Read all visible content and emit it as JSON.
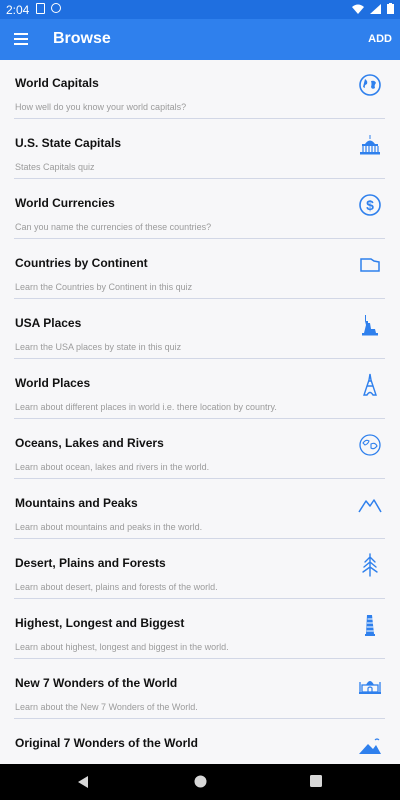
{
  "status": {
    "time": "2:04"
  },
  "appbar": {
    "title": "Browse",
    "add_label": "ADD"
  },
  "items": [
    {
      "title": "World Capitals",
      "desc": "How well do you know your world capitals?",
      "icon": "globe-icon"
    },
    {
      "title": "U.S. State Capitals",
      "desc": "States Capitals  quiz",
      "icon": "capitol-building-icon"
    },
    {
      "title": "World Currencies",
      "desc": "Can you name the currencies of these countries?",
      "icon": "dollar-icon"
    },
    {
      "title": "Countries by Continent",
      "desc": "Learn the Countries by Continent in this quiz",
      "icon": "map-outline-icon"
    },
    {
      "title": "USA Places",
      "desc": "Learn the USA places by state in this quiz",
      "icon": "statue-of-liberty-icon"
    },
    {
      "title": "World Places",
      "desc": "Learn about different places in world i.e. there location by country.",
      "icon": "eiffel-tower-icon"
    },
    {
      "title": "Oceans, Lakes and Rivers",
      "desc": "Learn about ocean, lakes and rivers in the world.",
      "icon": "earth-map-icon"
    },
    {
      "title": "Mountains and Peaks",
      "desc": "Learn about mountains and peaks in the world.",
      "icon": "mountain-icon"
    },
    {
      "title": "Desert, Plains and Forests",
      "desc": "Learn about desert, plains and forests of the world.",
      "icon": "pine-tree-icon"
    },
    {
      "title": "Highest, Longest and Biggest",
      "desc": "Learn about highest, longest and biggest in the world.",
      "icon": "leaning-tower-icon"
    },
    {
      "title": "New 7 Wonders of the World",
      "desc": "Learn about the New 7 Wonders of the World.",
      "icon": "taj-mahal-icon"
    },
    {
      "title": "Original 7 Wonders of the World",
      "desc": "",
      "icon": "pyramids-icon"
    }
  ],
  "colors": {
    "appbar": "#2f80ed",
    "statusbar": "#1f6fe0",
    "icon": "#2f80ed"
  }
}
